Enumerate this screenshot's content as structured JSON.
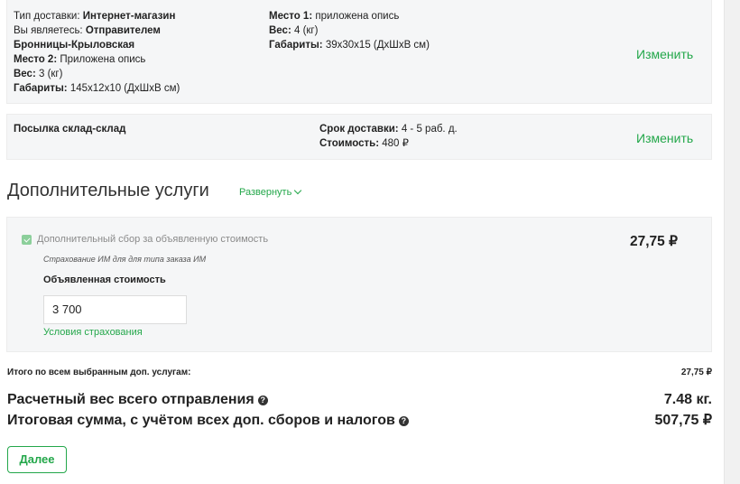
{
  "delivery": {
    "type_label": "Тип доставки:",
    "type_value": "Интернет-магазин",
    "role_label": "Вы являетесь:",
    "role_value": "Отправителем",
    "city": "Бронницы-Крыловская",
    "place2_label": "Место 2:",
    "place2_value": "Приложена опись",
    "weight2_label": "Вес:",
    "weight2_value": "3 (кг)",
    "dims2_label": "Габариты:",
    "dims2_value": "145x12x10 (ДxШxВ см)",
    "place1_label": "Место 1:",
    "place1_value": "приложена опись",
    "weight1_label": "Вес:",
    "weight1_value": "4 (кг)",
    "dims1_label": "Габариты:",
    "dims1_value": "39x30x15 (ДxШxВ см)",
    "change_label": "Изменить"
  },
  "tariff": {
    "name": "Посылка склад-склад",
    "term_label": "Срок доставки:",
    "term_value": "4 - 5 раб. д.",
    "cost_label": "Стоимость:",
    "cost_value": "480 ₽",
    "change_label": "Изменить"
  },
  "extra": {
    "title": "Дополнительные услуги",
    "expand_label": "Развернуть",
    "service_label": "Дополнительный сбор за объявленную стоимость",
    "service_checked": true,
    "service_note": "Страхование ИМ для для типа заказа ИМ",
    "service_price": "27,75 ₽",
    "declared_label": "Объявленная стоимость",
    "declared_value": "3 700",
    "terms_link": "Условия страхования"
  },
  "totals": {
    "services_label": "Итого по всем выбранным доп. услугам:",
    "services_value": "27,75 ₽",
    "weight_label": "Расчетный вес всего отправления",
    "weight_value": "7.48 кг.",
    "sum_label": "Итоговая сумма, с учётом всех доп. сборов и налогов",
    "sum_value": "507,75 ₽"
  },
  "actions": {
    "next_label": "Далее"
  },
  "colors": {
    "accent": "#23a74a",
    "panel": "#f5f6f7"
  }
}
